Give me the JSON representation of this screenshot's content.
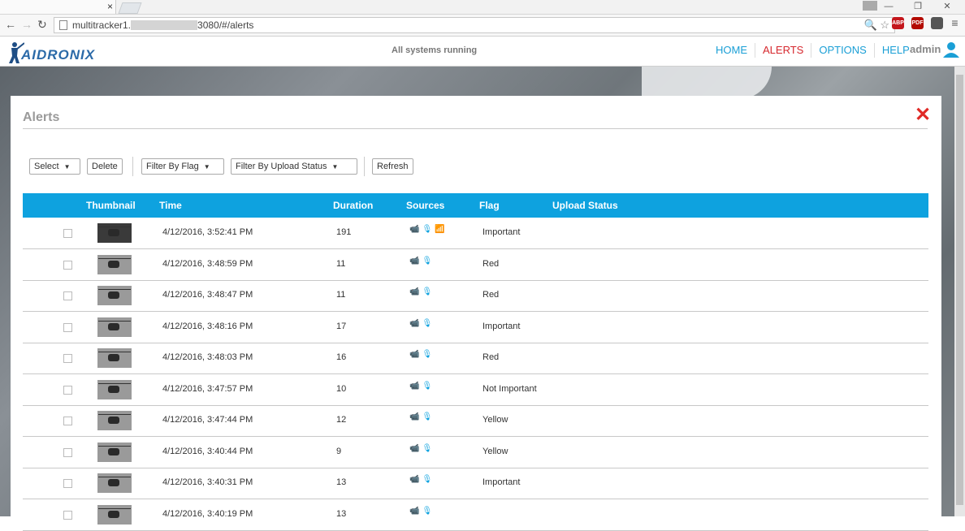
{
  "browser": {
    "tab_close": "×",
    "window_controls": [
      "—",
      "❐",
      "✕"
    ],
    "nav": {
      "back": "←",
      "forward": "→",
      "reload": "↻"
    },
    "url_prefix": "multitracker1.",
    "url_suffix": "3080/#/alerts",
    "omnibox_icons": "🔍 ☆",
    "extensions": [
      {
        "name": "abp",
        "label": "ABP",
        "color": "#c4161c"
      },
      {
        "name": "pdf",
        "label": "PDF",
        "color": "#b30b00"
      },
      {
        "name": "ext3",
        "label": "",
        "color": "#555555"
      },
      {
        "name": "menu",
        "label": "≡",
        "color": "#666666"
      }
    ]
  },
  "header": {
    "logo_text": "AIDRONIX",
    "status": "All systems running",
    "nav": [
      "HOME",
      "ALERTS",
      "OPTIONS",
      "HELP"
    ],
    "active_nav": "ALERTS",
    "user": "admin"
  },
  "modal": {
    "title": "Alerts",
    "close": "✕",
    "toolbar": {
      "select": "Select",
      "delete": "Delete",
      "filter_flag": "Filter By Flag",
      "filter_upload": "Filter By Upload Status",
      "refresh": "Refresh"
    },
    "columns": {
      "thumbnail": "Thumbnail",
      "time": "Time",
      "duration": "Duration",
      "sources": "Sources",
      "flag": "Flag",
      "upload_status": "Upload Status"
    },
    "rows": [
      {
        "time": "4/12/2016, 3:52:41 PM",
        "duration": "191",
        "flag": "Important",
        "sources": "📹🎙📶"
      },
      {
        "time": "4/12/2016, 3:48:59 PM",
        "duration": "11",
        "flag": "Red",
        "sources": "📹🎙"
      },
      {
        "time": "4/12/2016, 3:48:47 PM",
        "duration": "11",
        "flag": "Red",
        "sources": "📹🎙"
      },
      {
        "time": "4/12/2016, 3:48:16 PM",
        "duration": "17",
        "flag": "Important",
        "sources": "📹🎙"
      },
      {
        "time": "4/12/2016, 3:48:03 PM",
        "duration": "16",
        "flag": "Red",
        "sources": "📹🎙"
      },
      {
        "time": "4/12/2016, 3:47:57 PM",
        "duration": "10",
        "flag": "Not Important",
        "sources": "📹🎙"
      },
      {
        "time": "4/12/2016, 3:47:44 PM",
        "duration": "12",
        "flag": "Yellow",
        "sources": "📹🎙"
      },
      {
        "time": "4/12/2016, 3:40:44 PM",
        "duration": "9",
        "flag": "Yellow",
        "sources": "📹🎙"
      },
      {
        "time": "4/12/2016, 3:40:31 PM",
        "duration": "13",
        "flag": "Important",
        "sources": "📹🎙"
      },
      {
        "time": "4/12/2016, 3:40:19 PM",
        "duration": "13",
        "flag": "",
        "sources": "📹🎙"
      }
    ]
  },
  "colors": {
    "accent": "#0ea2df",
    "active_nav": "#d6282e",
    "close": "#e02a26"
  }
}
